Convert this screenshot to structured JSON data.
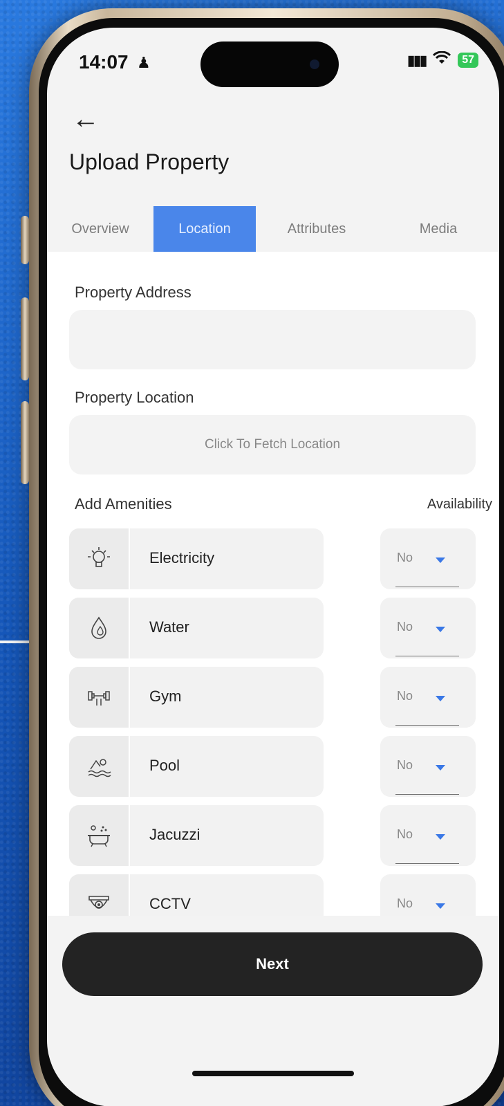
{
  "status_bar": {
    "time": "14:07",
    "battery": "57",
    "person_icon": "person-icon",
    "signal_icon": "cellular-signal-icon",
    "wifi_icon": "wifi-icon"
  },
  "header": {
    "back_icon": "back-arrow-icon",
    "title": "Upload Property"
  },
  "tabs": [
    {
      "label": "Overview",
      "active": false
    },
    {
      "label": "Location",
      "active": true
    },
    {
      "label": "Attributes",
      "active": false
    },
    {
      "label": "Media",
      "active": false
    }
  ],
  "form": {
    "address_label": "Property Address",
    "address_value": "",
    "location_label": "Property Location",
    "location_button": "Click To Fetch Location",
    "amenities_label": "Add Amenities",
    "availability_label": "Availability"
  },
  "amenities": [
    {
      "name": "Electricity",
      "icon": "lightbulb-icon",
      "availability": "No"
    },
    {
      "name": "Water",
      "icon": "water-drop-icon",
      "availability": "No"
    },
    {
      "name": "Gym",
      "icon": "dumbbell-icon",
      "availability": "No"
    },
    {
      "name": "Pool",
      "icon": "swimmer-icon",
      "availability": "No"
    },
    {
      "name": "Jacuzzi",
      "icon": "bathtub-icon",
      "availability": "No"
    },
    {
      "name": "CCTV",
      "icon": "cctv-camera-icon",
      "availability": "No"
    }
  ],
  "footer": {
    "next_label": "Next"
  },
  "colors": {
    "accent": "#4a86ea",
    "caret": "#3a78e6",
    "button_bg": "#232323",
    "background": "#1a63c7"
  }
}
